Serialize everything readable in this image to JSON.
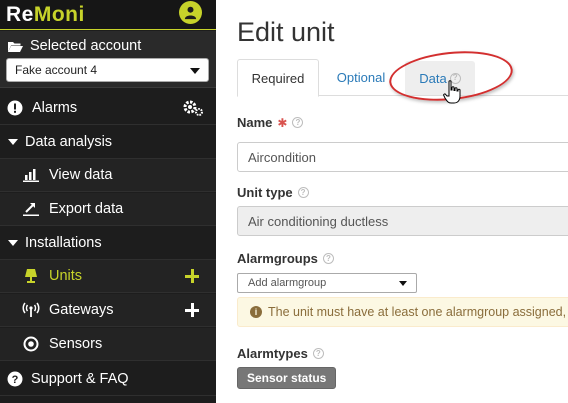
{
  "brand": {
    "logo_re": "Re",
    "logo_moni": "Moni",
    "accent": "#c7d32a"
  },
  "sidebar": {
    "account_header": "Selected account",
    "account_value": "Fake account 4",
    "items": [
      {
        "label": "Alarms",
        "icon": "exclamation-circle-icon",
        "extra": "gears-icon"
      },
      {
        "label": "Data analysis",
        "icon": "caret-down-icon"
      },
      {
        "label": "View data",
        "icon": "bar-chart-icon"
      },
      {
        "label": "Export data",
        "icon": "export-icon"
      },
      {
        "label": "Installations",
        "icon": "caret-down-icon"
      },
      {
        "label": "Units",
        "icon": "lamp-icon",
        "extra": "plus-icon",
        "active": true
      },
      {
        "label": "Gateways",
        "icon": "antenna-icon",
        "extra": "plus-icon"
      },
      {
        "label": "Sensors",
        "icon": "sensor-icon"
      },
      {
        "label": "Support & FAQ",
        "icon": "question-circle-icon"
      }
    ]
  },
  "main": {
    "title": "Edit unit",
    "tabs": [
      {
        "label": "Required",
        "active": true
      },
      {
        "label": "Optional"
      },
      {
        "label": "Data"
      }
    ],
    "name_label": "Name",
    "name_value": "Aircondition",
    "unit_type_label": "Unit type",
    "unit_type_value": "Air conditioning ductless",
    "alarmgroups_label": "Alarmgroups",
    "alarmgroups_placeholder": "Add alarmgroup",
    "alarmgroups_warning": "The unit must have at least one alarmgroup assigned,",
    "alarmtypes_label": "Alarmtypes",
    "alarmtypes_chip": "Sensor status",
    "colors": {
      "link": "#2a7ab8",
      "warning_bg": "#fcf8e3",
      "warning_text": "#8a6d3b",
      "annotation": "#d32f2f"
    }
  }
}
